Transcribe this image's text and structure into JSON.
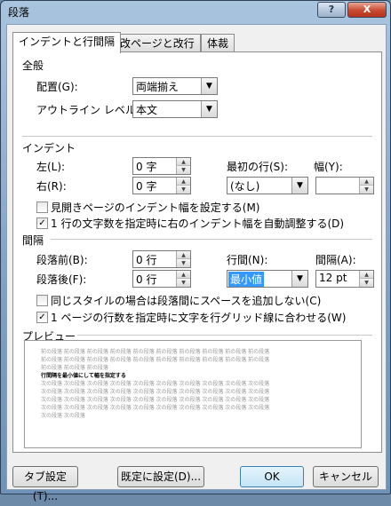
{
  "window": {
    "title": "段落",
    "help_label": "?",
    "close_label": "X"
  },
  "tabs": [
    {
      "label": "インデントと行間隔",
      "active": true
    },
    {
      "label": "改ページと改行",
      "active": false
    },
    {
      "label": "体裁",
      "active": false
    }
  ],
  "general": {
    "heading": "全般",
    "alignment_label": "配置(G):",
    "alignment_value": "両端揃え",
    "outline_label": "アウトライン レベル(O):",
    "outline_value": "本文"
  },
  "indent": {
    "heading": "インデント",
    "left_label": "左(L):",
    "left_value": "0 字",
    "right_label": "右(R):",
    "right_value": "0 字",
    "first_line_label": "最初の行(S):",
    "first_line_value": "(なし)",
    "width_label": "幅(Y):",
    "width_value": "",
    "mirror_label": "見開きページのインデント幅を設定する(M)",
    "mirror_checked": false,
    "auto_adjust_label": "1 行の文字数を指定時に右のインデント幅を自動調整する(D)",
    "auto_adjust_checked": true
  },
  "spacing": {
    "heading": "間隔",
    "before_label": "段落前(B):",
    "before_value": "0 行",
    "after_label": "段落後(F):",
    "after_value": "0 行",
    "line_spacing_label": "行間(N):",
    "line_spacing_value": "最小値",
    "at_label": "間隔(A):",
    "at_value": "12 pt",
    "no_space_same_style_label": "同じスタイルの場合は段落間にスペースを追加しない(C)",
    "no_space_same_style_checked": false,
    "snap_grid_label": "1 ページの行数を指定時に文字を行グリッド線に合わせる(W)",
    "snap_grid_checked": true
  },
  "preview": {
    "heading": "プレビュー",
    "previous_lines": [
      "前の段落 前の段落 前の段落 前の段落 前の段落 前の段落 前の段落 前の段落 前の段落 前の段落",
      "前の段落 前の段落 前の段落 前の段落 前の段落 前の段落 前の段落 前の段落 前の段落 前の段落",
      "前の段落 前の段落 前の段落"
    ],
    "target_line": "行間隔を最小値にして幅を指定する",
    "next_lines": [
      "次の段落 次の段落 次の段落 次の段落 次の段落 次の段落 次の段落 次の段落 次の段落 次の段落",
      "次の段落 次の段落 次の段落 次の段落 次の段落 次の段落 次の段落 次の段落 次の段落 次の段落",
      "次の段落 次の段落 次の段落 次の段落 次の段落 次の段落 次の段落 次の段落 次の段落 次の段落",
      "次の段落 次の段落 次の段落 次の段落 次の段落 次の段落 次の段落 次の段落 次の段落 次の段落",
      "次の段落 次の段落"
    ]
  },
  "buttons": {
    "tabs_label": "タブ設定(T)...",
    "default_label": "既定に設定(D)...",
    "ok_label": "OK",
    "cancel_label": "キャンセル"
  },
  "icons": {
    "spin_up": "▲",
    "spin_down": "▼",
    "dropdown": "▼",
    "check": "✓"
  }
}
